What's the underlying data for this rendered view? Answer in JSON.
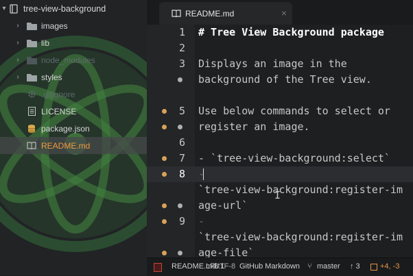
{
  "tree": {
    "root_label": "tree-view-background",
    "items": [
      {
        "label": "images",
        "type": "folder",
        "dim": false
      },
      {
        "label": "lib",
        "type": "folder",
        "dim": false
      },
      {
        "label": "node_modules",
        "type": "folder",
        "dim": true
      },
      {
        "label": "styles",
        "type": "folder",
        "dim": false
      },
      {
        "label": ".gitignore",
        "type": "gear",
        "dim": true
      },
      {
        "label": "LICENSE",
        "type": "file",
        "dim": false
      },
      {
        "label": "package.json",
        "type": "json",
        "dim": false
      },
      {
        "label": "README.md",
        "type": "book",
        "dim": false,
        "selected": true
      }
    ]
  },
  "tab": {
    "label": "README.md",
    "close": "×"
  },
  "editor": {
    "lines": [
      {
        "num": "1",
        "text": "# Tree View Background package"
      },
      {
        "num": "2",
        "text": ""
      },
      {
        "num": "3",
        "text": "Displays an image in the"
      },
      {
        "num": "",
        "text": "background of the Tree view."
      },
      {
        "num": "5",
        "text": "Use below commands to select or"
      },
      {
        "num": "",
        "text": "register an image."
      },
      {
        "num": "6",
        "text": ""
      },
      {
        "num": "7",
        "text": "- `tree-view-background:select`"
      },
      {
        "num": "8",
        "text": "-"
      },
      {
        "num": "",
        "text": "`tree-view-background:register-im"
      },
      {
        "num": "",
        "text": "age-url`"
      },
      {
        "num": "9",
        "text": "-"
      },
      {
        "num": "",
        "text": "`tree-view-background:register-im"
      },
      {
        "num": "",
        "text": "age-file`"
      }
    ]
  },
  "status": {
    "file": "README.md",
    "position": "8:1",
    "line_ending": "LF",
    "encoding": "UTF-8",
    "grammar": "GitHub Markdown",
    "branch": "master",
    "ahead": "↑ 3",
    "diff": "+4, -3"
  },
  "colors": {
    "accent": "#f19a3e",
    "gutter_marker": "#d8a25a",
    "logo": "#3b8a3c"
  }
}
